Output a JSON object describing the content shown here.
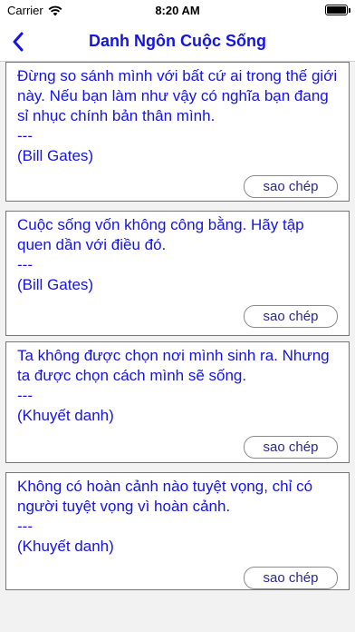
{
  "status_bar": {
    "carrier": "Carrier",
    "time": "8:20 AM"
  },
  "nav": {
    "title": "Danh Ngôn Cuộc Sống",
    "back_icon": "chevron-left-icon"
  },
  "quotes": [
    {
      "text": "Đừng so sánh mình với bất cứ ai trong thế giới này. Nếu bạn làm như vậy có nghĩa bạn đang sỉ nhục chính bản thân mình.\n---\n(Bill Gates)",
      "copy_label": "sao chép"
    },
    {
      "text": "Cuộc sống vốn không công bằng. Hãy tập quen dần với điều đó.\n---\n(Bill Gates)",
      "copy_label": "sao chép"
    },
    {
      "text": "Ta không được chọn nơi mình sinh ra. Nhưng ta được chọn cách mình sẽ sống.\n---\n(Khuyết danh)",
      "copy_label": "sao chép"
    },
    {
      "text": "Không có hoàn cảnh nào tuyệt vọng, chỉ có người tuyệt vọng vì hoàn cảnh.\n---\n(Khuyết danh)",
      "copy_label": "sao chép"
    }
  ],
  "colors": {
    "accent": "#1414e6",
    "background": "#f2f2f2"
  }
}
